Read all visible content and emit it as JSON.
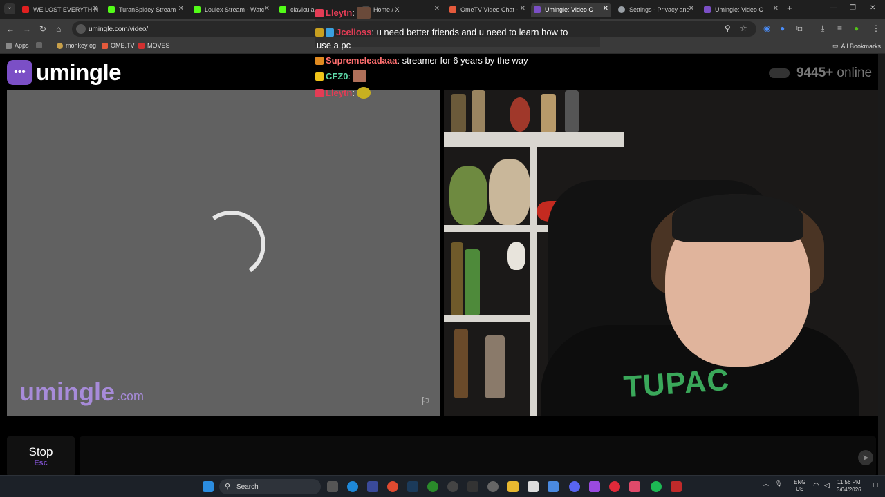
{
  "browser": {
    "tabs": [
      {
        "label": "WE LOST EVERYTHIN",
        "color": "#e02020"
      },
      {
        "label": "TuranSpidey Stream",
        "color": "#53fc18"
      },
      {
        "label": "Louiex Stream - Watc",
        "color": "#53fc18"
      },
      {
        "label": "clavicular Stream",
        "color": "#53fc18"
      },
      {
        "label": "Home / X",
        "color": "#000000"
      },
      {
        "label": "OmeTV Video Chat -",
        "color": "#e55a3c"
      },
      {
        "label": "Umingle: Video C",
        "color": "#7b4fc6"
      },
      {
        "label": "Settings - Privacy and",
        "color": "#9aa0a6"
      },
      {
        "label": "Umingle: Video C",
        "color": "#7b4fc6"
      }
    ],
    "new_tab": "+",
    "url": "umingle.com/video/",
    "bookmarks": [
      {
        "label": "Apps",
        "color": "#888888"
      },
      {
        "label": "monkey og",
        "color": "#c8a04a"
      },
      {
        "label": "OME.TV",
        "color": "#e55a3c"
      },
      {
        "label": "MOVES",
        "color": "#d23030"
      }
    ],
    "all_bookmarks": "All Bookmarks"
  },
  "app": {
    "logo_text": "umingle",
    "online_count": "9445+",
    "online_label": "online",
    "watermark": "umingle",
    "watermark_domain": ".com",
    "stop_label": "Stop",
    "stop_hint": "Esc"
  },
  "chat": [
    {
      "user": "Lleytn",
      "sep": ":",
      "text": "",
      "color": "#e43c55"
    },
    {
      "user": "Jcelioss",
      "sep": ":",
      "text": "u need better friends and u need to learn how to",
      "color": "#e43c55"
    },
    {
      "user": "",
      "sep": "",
      "text": "use a pc",
      "color": ""
    },
    {
      "user": "Supremeleadaaa",
      "sep": ":",
      "text": "streamer for 6 years by the way",
      "color": "#ff6f6f"
    },
    {
      "user": "CFZ0",
      "sep": ":",
      "text": "",
      "color": "#f0c419"
    },
    {
      "user": "Lleytn",
      "sep": ":",
      "text": "",
      "color": "#e43c55"
    }
  ],
  "stream_shirt": "TUPAC",
  "taskbar": {
    "search_placeholder": "Search",
    "lang": "ENG",
    "region": "US",
    "time": "11:56 PM",
    "date": "3/04/2026"
  }
}
